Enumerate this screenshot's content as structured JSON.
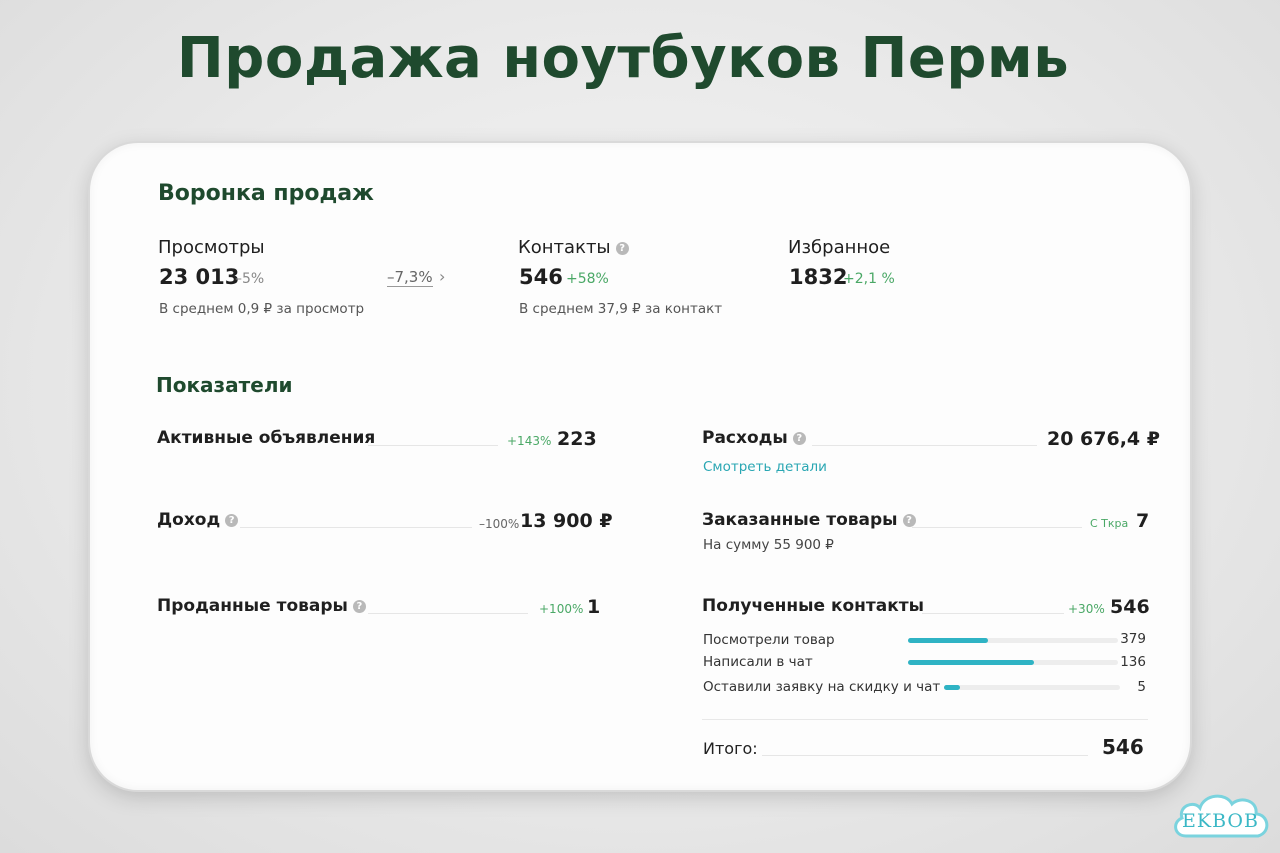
{
  "title": "Продажа ноутбуков Пермь",
  "funnel": {
    "heading": "Воронка продаж",
    "views": {
      "label": "Просмотры",
      "value": "23 013",
      "delta": "–5%",
      "compare": "–7,3%",
      "note": "В среднем 0,9 ₽ за просмотр"
    },
    "contacts": {
      "label": "Контакты",
      "value": "546",
      "delta": "+58%",
      "note": "В среднем 37,9 ₽ за контакт"
    },
    "favorites": {
      "label": "Избранное",
      "value": "1832",
      "delta": "+2,1 %"
    }
  },
  "metrics": {
    "heading": "Показатели",
    "active_ads": {
      "label": "Активные объявления",
      "delta": "+143%",
      "value": "223"
    },
    "income": {
      "label": "Доход",
      "delta": "–100%",
      "value": "13 900 ₽"
    },
    "sold": {
      "label": "Проданные товары",
      "delta": "+100%",
      "value": "1"
    },
    "expenses": {
      "label": "Расходы",
      "value": "20 676,4 ₽",
      "link": "Смотреть детали"
    },
    "ordered": {
      "label": "Заказанные товары",
      "tag": "С Ткра",
      "value": "7",
      "note": "На сумму 55 900 ₽"
    },
    "received": {
      "label": "Полученные контакты",
      "delta": "+30%",
      "value": "546",
      "rows": [
        {
          "label": "Посмотрели товар",
          "value": "379",
          "fraction": 0.379
        },
        {
          "label": "Написали в чат",
          "value": "136",
          "fraction": 0.6
        },
        {
          "label": "Оставили заявку на скидку и чат",
          "value": "5",
          "fraction": 0.09
        }
      ]
    },
    "total": {
      "label": "Итого:",
      "value": "546"
    }
  },
  "watermark": "EKBOB",
  "colors": {
    "accent_green": "#1f4a2e",
    "positive": "#4aa866",
    "teal": "#2fb3c4"
  }
}
